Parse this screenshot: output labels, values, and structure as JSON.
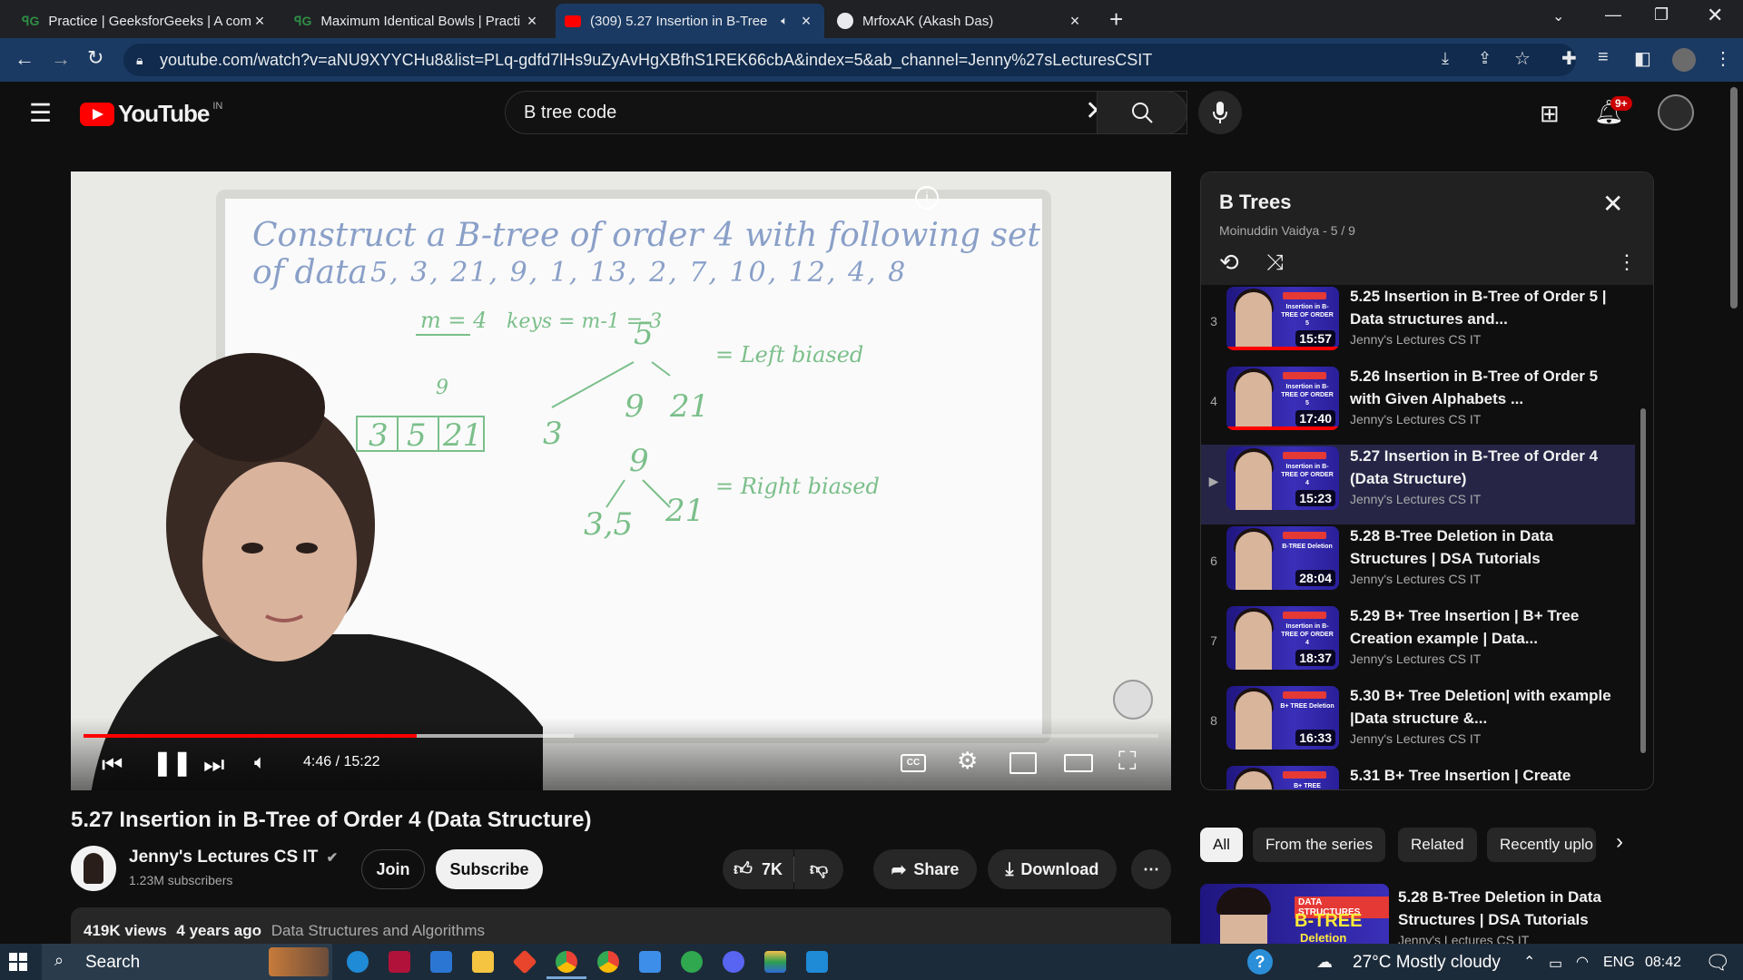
{
  "browser": {
    "tabs": [
      {
        "label": "Practice | GeeksforGeeks | A com",
        "icon": "gfg-icon",
        "active": false
      },
      {
        "label": "Maximum Identical Bowls | Practi",
        "icon": "gfg-icon",
        "active": false
      },
      {
        "label": "(309) 5.27 Insertion in B-Tree",
        "icon": "youtube-icon",
        "active": true
      },
      {
        "label": "MrfoxAK (Akash Das)",
        "icon": "github-icon",
        "active": false
      }
    ],
    "new_tab": "+",
    "url": "youtube.com/watch?v=aNU9XYYCHu8&list=PLq-gdfd7lHs9uZyAvHgXBfhS1REK66cbA&index=5&ab_channel=Jenny%27sLecturesCSIT"
  },
  "youtube": {
    "logo_text": "YouTube",
    "country": "IN",
    "search_value": "B tree code",
    "notifications_badge": "9+"
  },
  "video": {
    "board_lines": [
      "Construct a B-tree of order 4 with following set of data",
      "5, 3, 21, 9, 1, 13, 2, 7, 10, 12, 4, 8"
    ],
    "current_time": "4:46",
    "duration": "15:22",
    "time_display": "4:46 / 15:22",
    "progress": 0.31,
    "title": "5.27 Insertion in B-Tree of Order 4 (Data Structure)"
  },
  "channel": {
    "name": "Jenny's Lectures CS IT",
    "subscribers": "1.23M subscribers",
    "join": "Join",
    "subscribe": "Subscribe"
  },
  "actions": {
    "likes": "7K",
    "share": "Share",
    "download": "Download"
  },
  "description": {
    "views": "419K views",
    "age": "4 years ago",
    "category": "Data Structures and Algorithms"
  },
  "playlist": {
    "title": "B Trees",
    "subtitle": "Moinuddin Vaidya - 5 / 9",
    "items": [
      {
        "index": "3",
        "title": "5.25 Insertion in B-Tree of Order 5 | Data structures and...",
        "channel": "Jenny's Lectures CS IT",
        "duration": "15:57",
        "thumb_text": "Insertion in B-TREE OF ORDER 5",
        "current": false
      },
      {
        "index": "4",
        "title": "5.26 Insertion in B-Tree of Order 5 with Given Alphabets ...",
        "channel": "Jenny's Lectures CS IT",
        "duration": "17:40",
        "thumb_text": "Insertion in B-TREE OF ORDER 5",
        "current": false
      },
      {
        "index": "▶",
        "title": "5.27 Insertion in B-Tree of Order 4 (Data Structure)",
        "channel": "Jenny's Lectures CS IT",
        "duration": "15:23",
        "thumb_text": "Insertion in B-TREE OF ORDER 4",
        "current": true
      },
      {
        "index": "6",
        "title": "5.28 B-Tree Deletion in Data Structures | DSA Tutorials",
        "channel": "Jenny's Lectures CS IT",
        "duration": "28:04",
        "thumb_text": "B-TREE Deletion",
        "current": false
      },
      {
        "index": "7",
        "title": "5.29 B+ Tree Insertion | B+ Tree Creation example | Data...",
        "channel": "Jenny's Lectures CS IT",
        "duration": "18:37",
        "thumb_text": "Insertion in B-TREE OF ORDER 4",
        "current": false
      },
      {
        "index": "8",
        "title": "5.30 B+ Tree Deletion| with example |Data structure &...",
        "channel": "Jenny's Lectures CS IT",
        "duration": "16:33",
        "thumb_text": "B+ TREE Deletion",
        "current": false
      },
      {
        "index": "",
        "title": "5.31 B+ Tree Insertion | Create",
        "channel": "",
        "duration": "",
        "thumb_text": "B+ TREE",
        "current": false
      }
    ]
  },
  "chips": [
    "All",
    "From the series",
    "Related",
    "Recently uplo"
  ],
  "recommendation": {
    "title": "5.28 B-Tree Deletion in Data Structures | DSA Tutorials",
    "channel": "Jenny's Lectures CS IT",
    "thumb_tag": "DATA STRUCTURES",
    "thumb_title": "B-TREE",
    "thumb_sub": "Deletion"
  },
  "taskbar": {
    "search_placeholder": "Search",
    "weather": "27°C  Mostly cloudy",
    "language": "ENG",
    "time": "08:42"
  },
  "colors": {
    "accent_red": "#ff0000",
    "browser_active": "#1a3a63",
    "playlist_current": "#262546"
  }
}
